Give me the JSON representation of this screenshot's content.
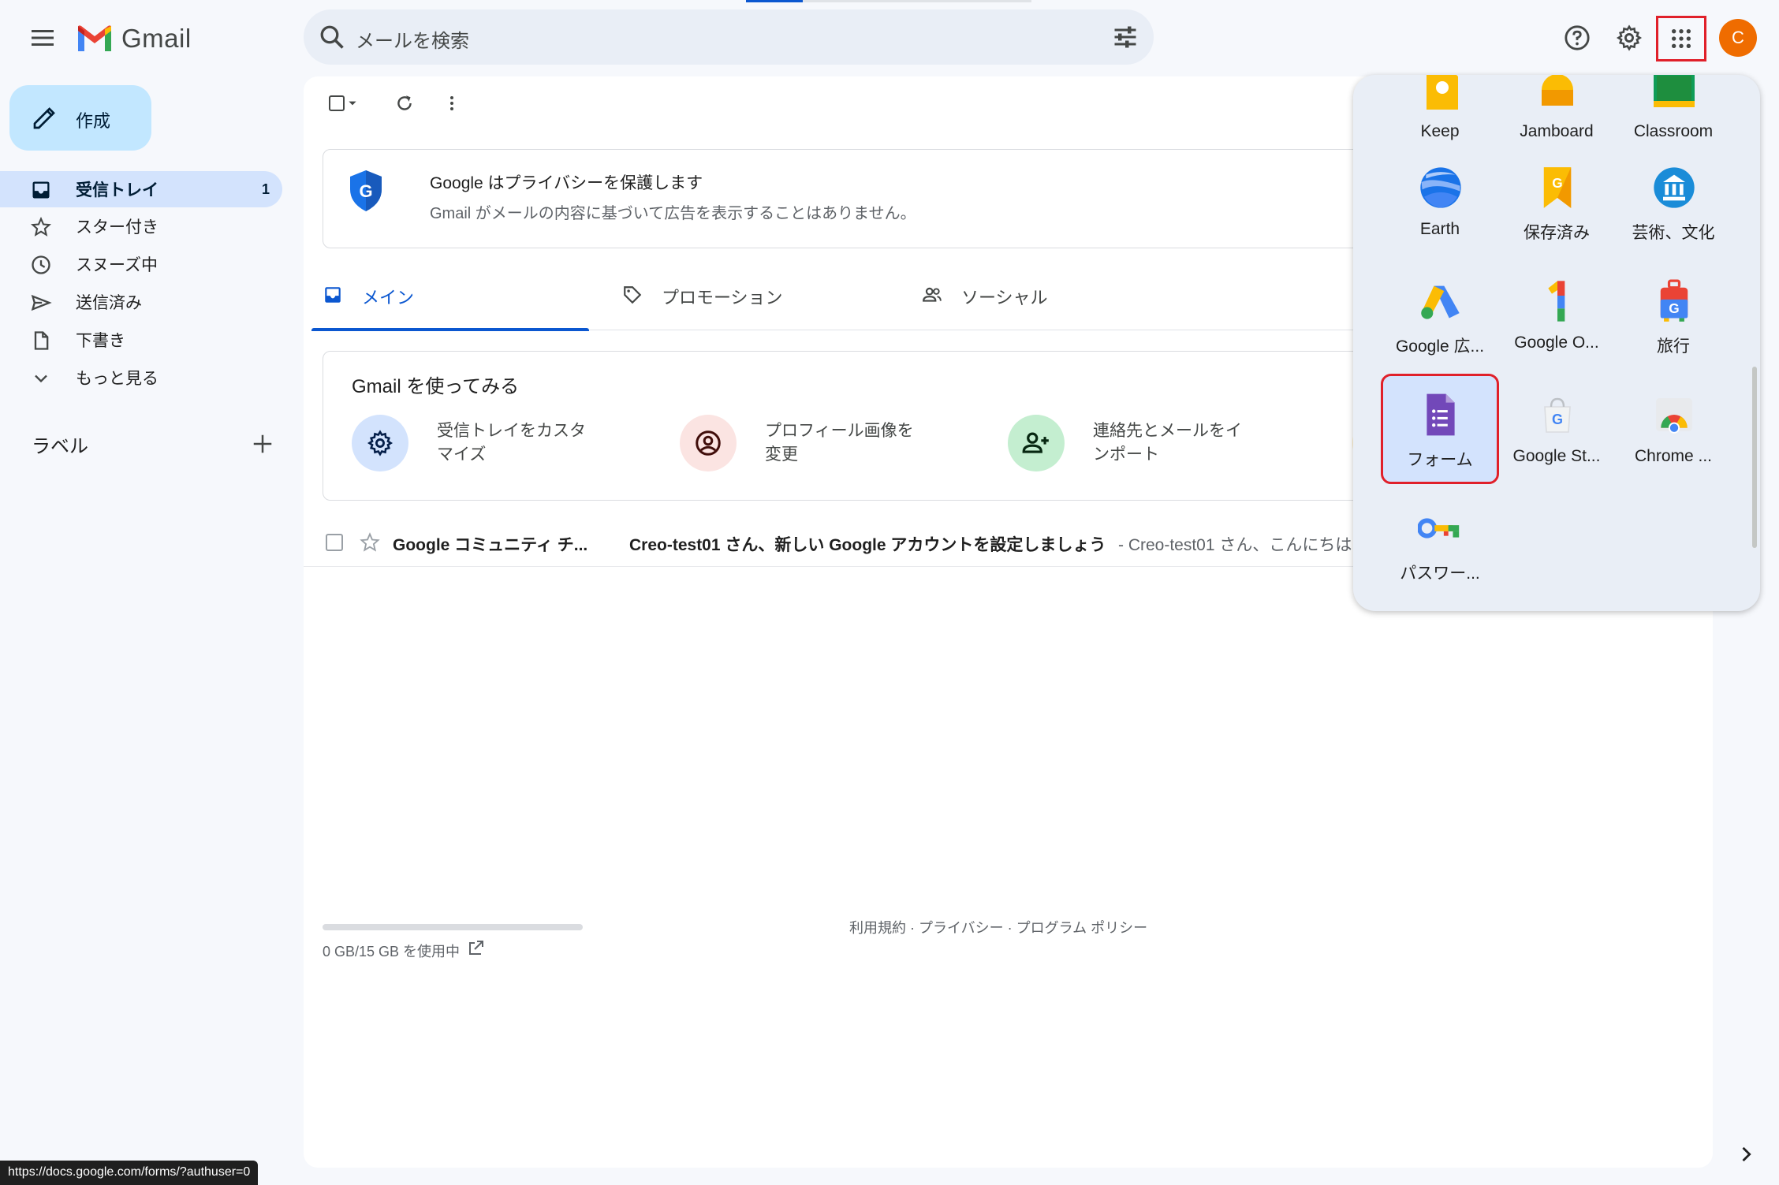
{
  "header": {
    "app_name": "Gmail",
    "search_placeholder": "メールを検索",
    "avatar_initial": "C"
  },
  "sidebar": {
    "compose_label": "作成",
    "items": [
      {
        "label": "受信トレイ",
        "count": "1",
        "icon": "inbox-icon"
      },
      {
        "label": "スター付き",
        "icon": "star-icon"
      },
      {
        "label": "スヌーズ中",
        "icon": "clock-icon"
      },
      {
        "label": "送信済み",
        "icon": "send-icon"
      },
      {
        "label": "下書き",
        "icon": "draft-icon"
      },
      {
        "label": "もっと見る",
        "icon": "chevron-down-icon"
      }
    ],
    "labels_heading": "ラベル"
  },
  "privacy": {
    "title": "Google はプライバシーを保護します",
    "subtitle": "Gmail がメールの内容に基づいて広告を表示することはありません。"
  },
  "tabs": [
    {
      "label": "メイン",
      "icon": "inbox-icon",
      "active": true
    },
    {
      "label": "プロモーション",
      "icon": "tag-icon",
      "active": false
    },
    {
      "label": "ソーシャル",
      "icon": "people-icon",
      "active": false
    }
  ],
  "tryout": {
    "title": "Gmail を使ってみる",
    "items": [
      {
        "text": "受信トレイをカスタマイズ",
        "icon": "gear-icon"
      },
      {
        "text": "プロフィール画像を変更",
        "icon": "account-icon"
      },
      {
        "text": "連絡先とメールをインポート",
        "icon": "person-add-icon"
      }
    ]
  },
  "mail": [
    {
      "sender": "Google コミュニティ チ...",
      "subject": "Creo-test01 さん、新しい Google アカウントを設定しましょう",
      "snippet": " - Creo-test01 さん、こんにちは"
    }
  ],
  "footer": {
    "storage": "0 GB/15 GB を使用中",
    "links": "利用規約 · プライバシー · プログラム ポリシー"
  },
  "apps": [
    {
      "label": "Keep",
      "icon": "keep-icon"
    },
    {
      "label": "Jamboard",
      "icon": "jamboard-icon"
    },
    {
      "label": "Classroom",
      "icon": "classroom-icon"
    },
    {
      "label": "Earth",
      "icon": "earth-icon"
    },
    {
      "label": "保存済み",
      "icon": "saved-icon"
    },
    {
      "label": "芸術、文化",
      "icon": "arts-culture-icon"
    },
    {
      "label": "Google 広...",
      "icon": "google-ads-icon"
    },
    {
      "label": "Google O...",
      "icon": "google-one-icon"
    },
    {
      "label": "旅行",
      "icon": "travel-icon"
    },
    {
      "label": "フォーム",
      "icon": "forms-icon",
      "selected": true
    },
    {
      "label": "Google St...",
      "icon": "google-store-icon"
    },
    {
      "label": "Chrome ...",
      "icon": "chrome-icon"
    },
    {
      "label": "パスワー...",
      "icon": "password-manager-icon"
    }
  ],
  "status_url": "https://docs.google.com/forms/?authuser=0",
  "colors": {
    "accent": "#0b57d0",
    "compose_bg": "#c2e7ff",
    "active_nav": "#d3e3fd",
    "highlight": "#e0202a",
    "avatar": "#ef6c00"
  }
}
